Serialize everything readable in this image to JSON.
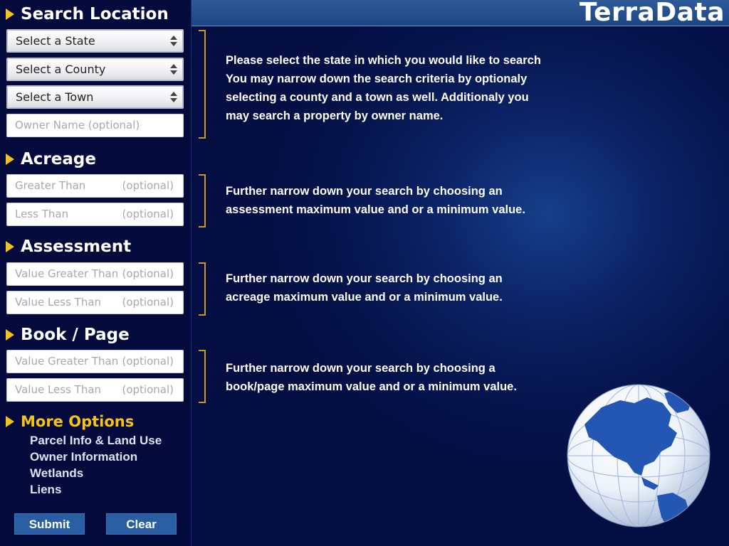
{
  "app": {
    "brand": "TerraData"
  },
  "sidebar": {
    "search_location": {
      "title": "Search Location",
      "state_select": "Select a State",
      "county_select": "Select a County",
      "town_select": "Select a Town",
      "owner_placeholder": "Owner Name (optional)"
    },
    "acreage": {
      "title": "Acreage",
      "greater_label": "Greater Than",
      "greater_optional": "(optional)",
      "less_label": "Less Than",
      "less_optional": "(optional)"
    },
    "assessment": {
      "title": "Assessment",
      "greater_label": "Value Greater Than",
      "greater_optional": "(optional)",
      "less_label": "Value Less Than",
      "less_optional": "(optional)"
    },
    "book_page": {
      "title": "Book / Page",
      "greater_label": "Value Greater Than",
      "greater_optional": "(optional)",
      "less_label": "Value Less Than",
      "less_optional": "(optional)"
    },
    "more_options": {
      "title": "More Options",
      "items": [
        "Parcel Info & Land Use",
        "Owner Information",
        "Wetlands",
        "Liens"
      ]
    },
    "submit_label": "Submit",
    "clear_label": "Clear"
  },
  "help": {
    "location": {
      "lines": [
        "Please select the state in which you would like to search",
        "You may narrow down the search criteria by optionaly",
        "selecting a county and a town as well. Additionaly you",
        "may search a property by owner name."
      ]
    },
    "acreage": {
      "lines": [
        "Further narrow down your search by choosing an",
        "assessment maximum value and or a minimum value."
      ]
    },
    "assessment": {
      "lines": [
        "Further narrow down your search by choosing an",
        "acreage maximum value and or a minimum value."
      ]
    },
    "book_page": {
      "lines": [
        "Further narrow down your search by choosing a",
        "book/page maximum value and or a minimum value."
      ]
    }
  },
  "colors": {
    "accent_yellow": "#f6c417",
    "button_blue": "#2a5ea2",
    "sidebar_bg": "#050a3c",
    "bracket_gold": "#c9962c"
  },
  "icons": {
    "section_marker": "triangle-right-icon",
    "select_arrows": "updown-arrows-icon",
    "globe": "globe-icon"
  }
}
